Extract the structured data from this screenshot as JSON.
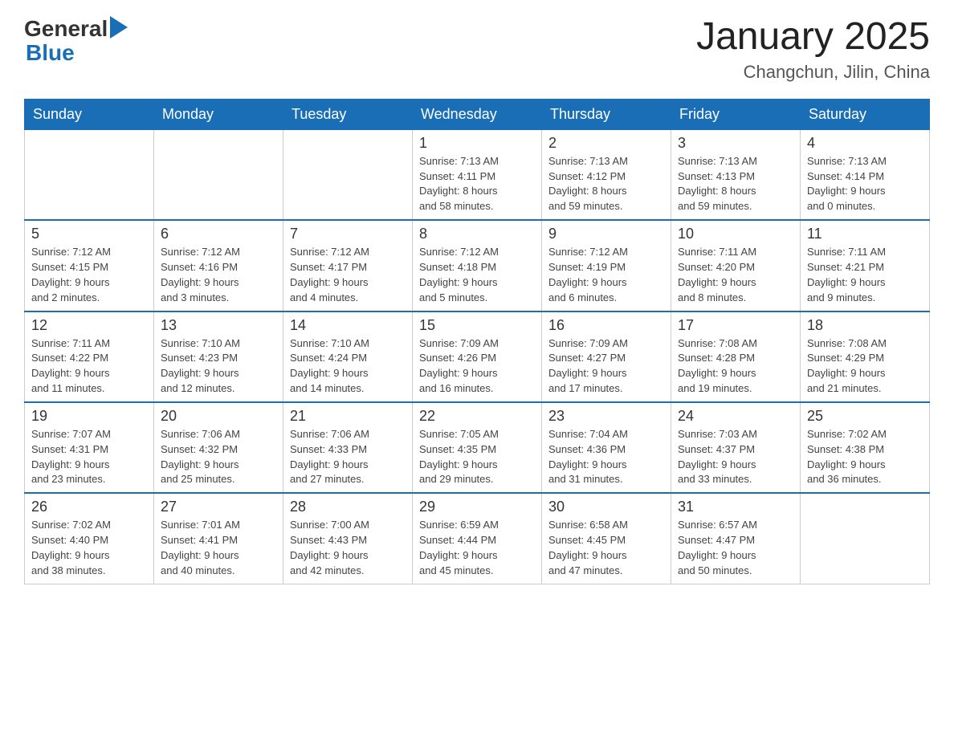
{
  "header": {
    "title": "January 2025",
    "subtitle": "Changchun, Jilin, China",
    "logo_general": "General",
    "logo_blue": "Blue"
  },
  "days_of_week": [
    "Sunday",
    "Monday",
    "Tuesday",
    "Wednesday",
    "Thursday",
    "Friday",
    "Saturday"
  ],
  "weeks": [
    [
      {
        "day": "",
        "info": ""
      },
      {
        "day": "",
        "info": ""
      },
      {
        "day": "",
        "info": ""
      },
      {
        "day": "1",
        "info": "Sunrise: 7:13 AM\nSunset: 4:11 PM\nDaylight: 8 hours\nand 58 minutes."
      },
      {
        "day": "2",
        "info": "Sunrise: 7:13 AM\nSunset: 4:12 PM\nDaylight: 8 hours\nand 59 minutes."
      },
      {
        "day": "3",
        "info": "Sunrise: 7:13 AM\nSunset: 4:13 PM\nDaylight: 8 hours\nand 59 minutes."
      },
      {
        "day": "4",
        "info": "Sunrise: 7:13 AM\nSunset: 4:14 PM\nDaylight: 9 hours\nand 0 minutes."
      }
    ],
    [
      {
        "day": "5",
        "info": "Sunrise: 7:12 AM\nSunset: 4:15 PM\nDaylight: 9 hours\nand 2 minutes."
      },
      {
        "day": "6",
        "info": "Sunrise: 7:12 AM\nSunset: 4:16 PM\nDaylight: 9 hours\nand 3 minutes."
      },
      {
        "day": "7",
        "info": "Sunrise: 7:12 AM\nSunset: 4:17 PM\nDaylight: 9 hours\nand 4 minutes."
      },
      {
        "day": "8",
        "info": "Sunrise: 7:12 AM\nSunset: 4:18 PM\nDaylight: 9 hours\nand 5 minutes."
      },
      {
        "day": "9",
        "info": "Sunrise: 7:12 AM\nSunset: 4:19 PM\nDaylight: 9 hours\nand 6 minutes."
      },
      {
        "day": "10",
        "info": "Sunrise: 7:11 AM\nSunset: 4:20 PM\nDaylight: 9 hours\nand 8 minutes."
      },
      {
        "day": "11",
        "info": "Sunrise: 7:11 AM\nSunset: 4:21 PM\nDaylight: 9 hours\nand 9 minutes."
      }
    ],
    [
      {
        "day": "12",
        "info": "Sunrise: 7:11 AM\nSunset: 4:22 PM\nDaylight: 9 hours\nand 11 minutes."
      },
      {
        "day": "13",
        "info": "Sunrise: 7:10 AM\nSunset: 4:23 PM\nDaylight: 9 hours\nand 12 minutes."
      },
      {
        "day": "14",
        "info": "Sunrise: 7:10 AM\nSunset: 4:24 PM\nDaylight: 9 hours\nand 14 minutes."
      },
      {
        "day": "15",
        "info": "Sunrise: 7:09 AM\nSunset: 4:26 PM\nDaylight: 9 hours\nand 16 minutes."
      },
      {
        "day": "16",
        "info": "Sunrise: 7:09 AM\nSunset: 4:27 PM\nDaylight: 9 hours\nand 17 minutes."
      },
      {
        "day": "17",
        "info": "Sunrise: 7:08 AM\nSunset: 4:28 PM\nDaylight: 9 hours\nand 19 minutes."
      },
      {
        "day": "18",
        "info": "Sunrise: 7:08 AM\nSunset: 4:29 PM\nDaylight: 9 hours\nand 21 minutes."
      }
    ],
    [
      {
        "day": "19",
        "info": "Sunrise: 7:07 AM\nSunset: 4:31 PM\nDaylight: 9 hours\nand 23 minutes."
      },
      {
        "day": "20",
        "info": "Sunrise: 7:06 AM\nSunset: 4:32 PM\nDaylight: 9 hours\nand 25 minutes."
      },
      {
        "day": "21",
        "info": "Sunrise: 7:06 AM\nSunset: 4:33 PM\nDaylight: 9 hours\nand 27 minutes."
      },
      {
        "day": "22",
        "info": "Sunrise: 7:05 AM\nSunset: 4:35 PM\nDaylight: 9 hours\nand 29 minutes."
      },
      {
        "day": "23",
        "info": "Sunrise: 7:04 AM\nSunset: 4:36 PM\nDaylight: 9 hours\nand 31 minutes."
      },
      {
        "day": "24",
        "info": "Sunrise: 7:03 AM\nSunset: 4:37 PM\nDaylight: 9 hours\nand 33 minutes."
      },
      {
        "day": "25",
        "info": "Sunrise: 7:02 AM\nSunset: 4:38 PM\nDaylight: 9 hours\nand 36 minutes."
      }
    ],
    [
      {
        "day": "26",
        "info": "Sunrise: 7:02 AM\nSunset: 4:40 PM\nDaylight: 9 hours\nand 38 minutes."
      },
      {
        "day": "27",
        "info": "Sunrise: 7:01 AM\nSunset: 4:41 PM\nDaylight: 9 hours\nand 40 minutes."
      },
      {
        "day": "28",
        "info": "Sunrise: 7:00 AM\nSunset: 4:43 PM\nDaylight: 9 hours\nand 42 minutes."
      },
      {
        "day": "29",
        "info": "Sunrise: 6:59 AM\nSunset: 4:44 PM\nDaylight: 9 hours\nand 45 minutes."
      },
      {
        "day": "30",
        "info": "Sunrise: 6:58 AM\nSunset: 4:45 PM\nDaylight: 9 hours\nand 47 minutes."
      },
      {
        "day": "31",
        "info": "Sunrise: 6:57 AM\nSunset: 4:47 PM\nDaylight: 9 hours\nand 50 minutes."
      },
      {
        "day": "",
        "info": ""
      }
    ]
  ]
}
